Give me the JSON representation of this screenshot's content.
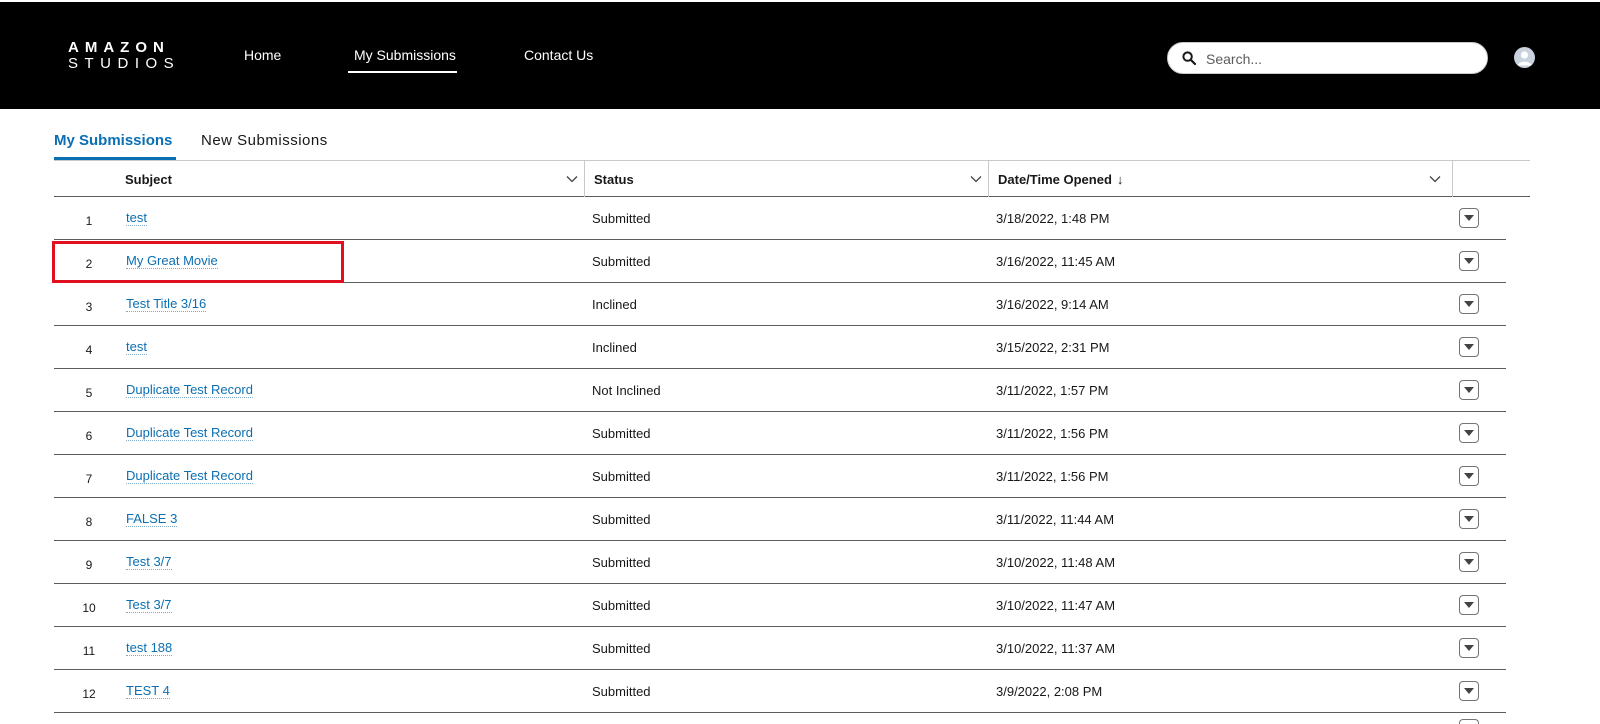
{
  "header": {
    "logo_line1": "AMAZON",
    "logo_line2": "STUDIOS",
    "nav": {
      "home": "Home",
      "my_submissions": "My Submissions",
      "contact_us": "Contact Us"
    },
    "search": {
      "placeholder": "Search..."
    }
  },
  "tabs": {
    "active": "My Submissions",
    "new": "New Submissions"
  },
  "table": {
    "columns": {
      "subject": "Subject",
      "status": "Status",
      "date": "Date/Time Opened",
      "sort_indicator": "↓"
    },
    "rows": [
      {
        "num": "1",
        "subject": "test",
        "status": "Submitted",
        "date": "3/18/2022, 1:48 PM"
      },
      {
        "num": "2",
        "subject": "My Great Movie",
        "status": "Submitted",
        "date": "3/16/2022, 11:45 AM"
      },
      {
        "num": "3",
        "subject": "Test Title 3/16",
        "status": "Inclined",
        "date": "3/16/2022, 9:14 AM"
      },
      {
        "num": "4",
        "subject": "test",
        "status": "Inclined",
        "date": "3/15/2022, 2:31 PM"
      },
      {
        "num": "5",
        "subject": "Duplicate Test Record",
        "status": "Not Inclined",
        "date": "3/11/2022, 1:57 PM"
      },
      {
        "num": "6",
        "subject": "Duplicate Test Record",
        "status": "Submitted",
        "date": "3/11/2022, 1:56 PM"
      },
      {
        "num": "7",
        "subject": "Duplicate Test Record",
        "status": "Submitted",
        "date": "3/11/2022, 1:56 PM"
      },
      {
        "num": "8",
        "subject": "FALSE 3",
        "status": "Submitted",
        "date": "3/11/2022, 11:44 AM"
      },
      {
        "num": "9",
        "subject": "Test 3/7",
        "status": "Submitted",
        "date": "3/10/2022, 11:48 AM"
      },
      {
        "num": "10",
        "subject": "Test 3/7",
        "status": "Submitted",
        "date": "3/10/2022, 11:47 AM"
      },
      {
        "num": "11",
        "subject": "test 188",
        "status": "Submitted",
        "date": "3/10/2022, 11:37 AM"
      },
      {
        "num": "12",
        "subject": "TEST 4",
        "status": "Submitted",
        "date": "3/9/2022, 2:08 PM"
      }
    ]
  },
  "icons": {
    "search": "search-icon",
    "avatar": "user-avatar-icon",
    "column_menu": "chevron-down-icon",
    "row_action": "row-action-dropdown-icon"
  },
  "colors": {
    "header_bg": "#000000",
    "link": "#0b6fb3",
    "highlight": "#e01020"
  }
}
